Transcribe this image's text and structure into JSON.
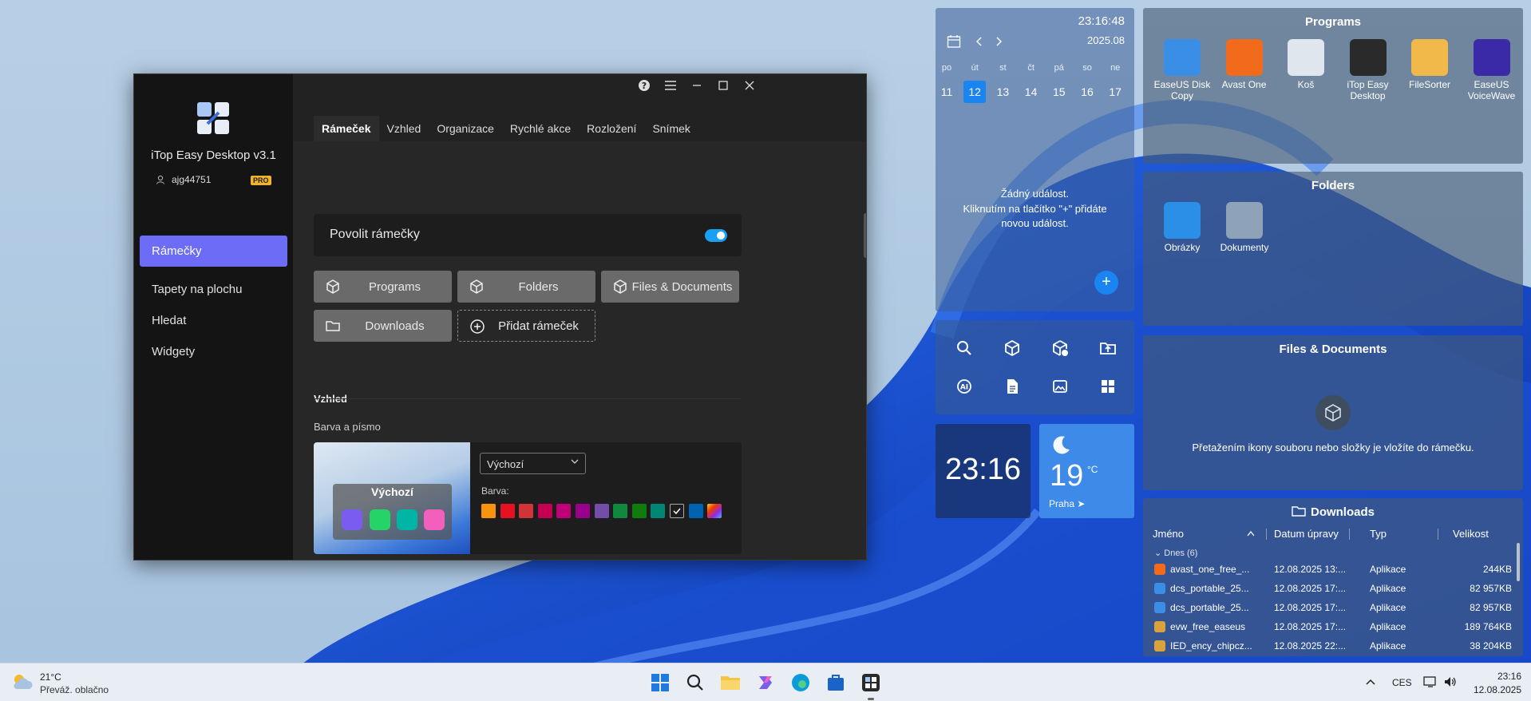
{
  "app": {
    "name": "iTop Easy Desktop v3.1",
    "user": "ajg44751",
    "badge": "PRO",
    "nav": [
      "Rámečky",
      "Tapety na plochu",
      "Hledat",
      "Widgety"
    ],
    "tabs": [
      "Rámeček",
      "Vzhled",
      "Organizace",
      "Rychlé akce",
      "Rozložení",
      "Snímek"
    ],
    "toggle_label": "Povolit rámečky",
    "toggle_on": true,
    "frames": [
      "Programs",
      "Folders",
      "Files & Documents",
      "Downloads"
    ],
    "add_frame": "Přidat rámeček",
    "section_title": "Vzhled",
    "section_sub": "Barva a písmo",
    "preview_title": "Výchozí",
    "select_value": "Výchozí",
    "color_label": "Barva:",
    "swatches": [
      "#f7930e",
      "#e81123",
      "#d13438",
      "#c30052",
      "#bf0077",
      "#9a0089",
      "#744da9",
      "#10893e",
      "#107c10",
      "#018574",
      "#1d1d1d",
      "#0063b1"
    ]
  },
  "calendar": {
    "time": "23:16:48",
    "month": "2025.08",
    "day_names": [
      "po",
      "út",
      "st",
      "čt",
      "pá",
      "so",
      "ne"
    ],
    "days": [
      "11",
      "12",
      "13",
      "14",
      "15",
      "16",
      "17"
    ],
    "today": "12",
    "empty_line1": "Žádný událost.",
    "empty_line2": "Kliknutím na tlačítko \"+\" přidáte",
    "empty_line3": "novou událost.",
    "add": "+"
  },
  "quick_icons": [
    "search-icon",
    "cube-icon",
    "cube-add-icon",
    "folder-upload-icon",
    "ai-icon",
    "document-icon",
    "image-icon",
    "grid-icon"
  ],
  "clock": "23:16",
  "weather": {
    "temp": "19",
    "unit": "°C",
    "city": "Praha"
  },
  "programs": {
    "title": "Programs",
    "items": [
      {
        "label": [
          "EaseUS Disk",
          "Copy"
        ],
        "color": "#3a8ee6"
      },
      {
        "label": [
          "Avast One",
          ""
        ],
        "color": "#f26b1d"
      },
      {
        "label": [
          "Koš",
          ""
        ],
        "color": "#dfe6ee"
      },
      {
        "label": [
          "iTop Easy",
          "Desktop"
        ],
        "color": "#2a2a2a"
      },
      {
        "label": [
          "FileSorter",
          ""
        ],
        "color": "#f0b94a"
      },
      {
        "label": [
          "EaseUS",
          "VoiceWave"
        ],
        "color": "#3b2aa8"
      }
    ]
  },
  "folders": {
    "title": "Folders",
    "items": [
      {
        "label": "Obrázky",
        "color": "#2b8fe8"
      },
      {
        "label": "Dokumenty",
        "color": "#8fa3b8"
      }
    ]
  },
  "files": {
    "title": "Files & Documents",
    "empty": "Přetažením ikony souboru nebo složky je vložíte do rámečku."
  },
  "downloads": {
    "title": "Downloads",
    "headers": [
      "Jméno",
      "Datum úpravy",
      "Typ",
      "Velikost"
    ],
    "group": "Dnes (6)",
    "rows": [
      {
        "name": "avast_one_free_...",
        "date": "12.08.2025 13:...",
        "type": "Aplikace",
        "size": "244KB",
        "color": "#f26b1d"
      },
      {
        "name": "dcs_portable_25...",
        "date": "12.08.2025 17:...",
        "type": "Aplikace",
        "size": "82 957KB",
        "color": "#3a8ee6"
      },
      {
        "name": "dcs_portable_25...",
        "date": "12.08.2025 17:...",
        "type": "Aplikace",
        "size": "82 957KB",
        "color": "#3a8ee6"
      },
      {
        "name": "evw_free_easeus",
        "date": "12.08.2025 17:...",
        "type": "Aplikace",
        "size": "189 764KB",
        "color": "#d9a23c"
      },
      {
        "name": "IED_ency_chipcz...",
        "date": "12.08.2025 22:...",
        "type": "Aplikace",
        "size": "38 204KB",
        "color": "#d9a23c"
      }
    ]
  },
  "taskbar": {
    "weather_temp": "21°C",
    "weather_desc": "Převáž. oblačno",
    "lang": "CES",
    "time": "23:16",
    "date": "12.08.2025"
  }
}
